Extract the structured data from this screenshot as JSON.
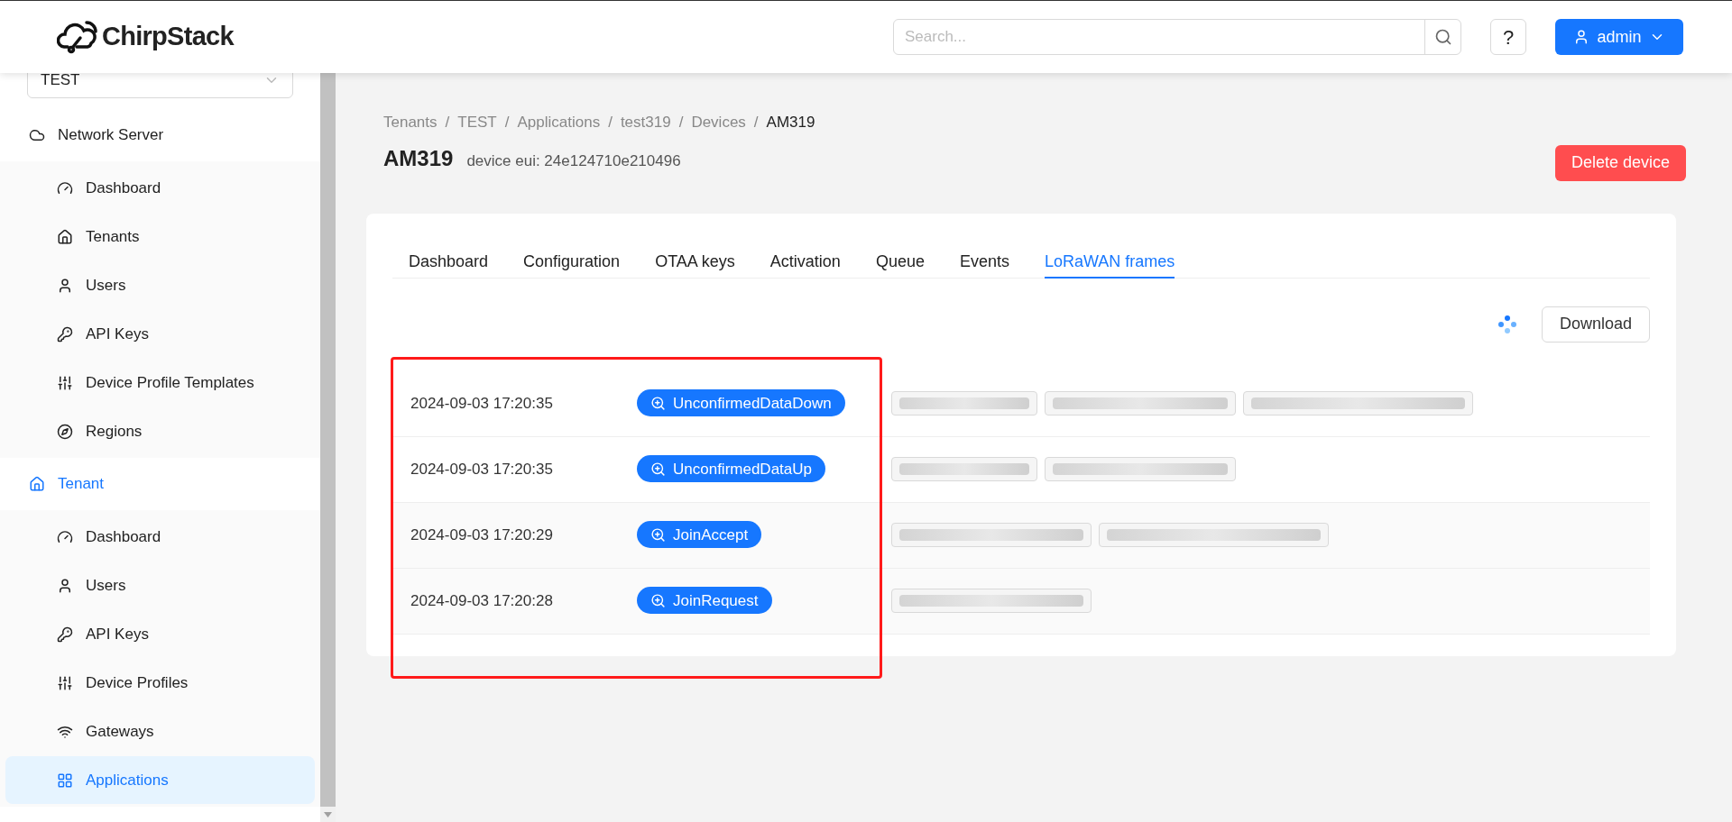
{
  "header": {
    "logo": "ChirpStack",
    "search": {
      "placeholder": "Search..."
    },
    "help": "?",
    "user": "admin"
  },
  "sidebar": {
    "tenant_select": "TEST",
    "sections": [
      {
        "label": "Network Server",
        "active": false,
        "items": [
          {
            "label": "Dashboard",
            "selected": false
          },
          {
            "label": "Tenants",
            "selected": false
          },
          {
            "label": "Users",
            "selected": false
          },
          {
            "label": "API Keys",
            "selected": false
          },
          {
            "label": "Device Profile Templates",
            "selected": false
          },
          {
            "label": "Regions",
            "selected": false
          }
        ]
      },
      {
        "label": "Tenant",
        "active": true,
        "items": [
          {
            "label": "Dashboard",
            "selected": false
          },
          {
            "label": "Users",
            "selected": false
          },
          {
            "label": "API Keys",
            "selected": false
          },
          {
            "label": "Device Profiles",
            "selected": false
          },
          {
            "label": "Gateways",
            "selected": false
          },
          {
            "label": "Applications",
            "selected": true
          }
        ]
      }
    ]
  },
  "breadcrumb_separator": "/",
  "breadcrumb": [
    "Tenants",
    "TEST",
    "Applications",
    "test319",
    "Devices",
    "AM319"
  ],
  "title": "AM319",
  "subtitle": "device eui: 24e124710e210496",
  "delete_button": "Delete device",
  "tabs": [
    {
      "label": "Dashboard",
      "selected": false
    },
    {
      "label": "Configuration",
      "selected": false
    },
    {
      "label": "OTAA keys",
      "selected": false
    },
    {
      "label": "Activation",
      "selected": false
    },
    {
      "label": "Queue",
      "selected": false
    },
    {
      "label": "Events",
      "selected": false
    },
    {
      "label": "LoRaWAN frames",
      "selected": true
    }
  ],
  "download_button": "Download",
  "frames": [
    {
      "time": "2024-09-03 17:20:35",
      "type": "UnconfirmedDataDown",
      "tags": [
        {
          "kind": "redacted"
        },
        {
          "kind": "redacted"
        },
        {
          "kind": "redacted"
        }
      ]
    },
    {
      "time": "2024-09-03 17:20:35",
      "type": "UnconfirmedDataUp",
      "tags": [
        {
          "kind": "redacted"
        },
        {
          "kind": "redacted"
        }
      ]
    },
    {
      "time": "2024-09-03 17:20:29",
      "type": "JoinAccept",
      "tags": [
        {
          "kind": "redacted"
        },
        {
          "kind": "redacted"
        }
      ]
    },
    {
      "time": "2024-09-03 17:20:28",
      "type": "JoinRequest",
      "tags": [
        {
          "kind": "redacted"
        }
      ]
    }
  ]
}
